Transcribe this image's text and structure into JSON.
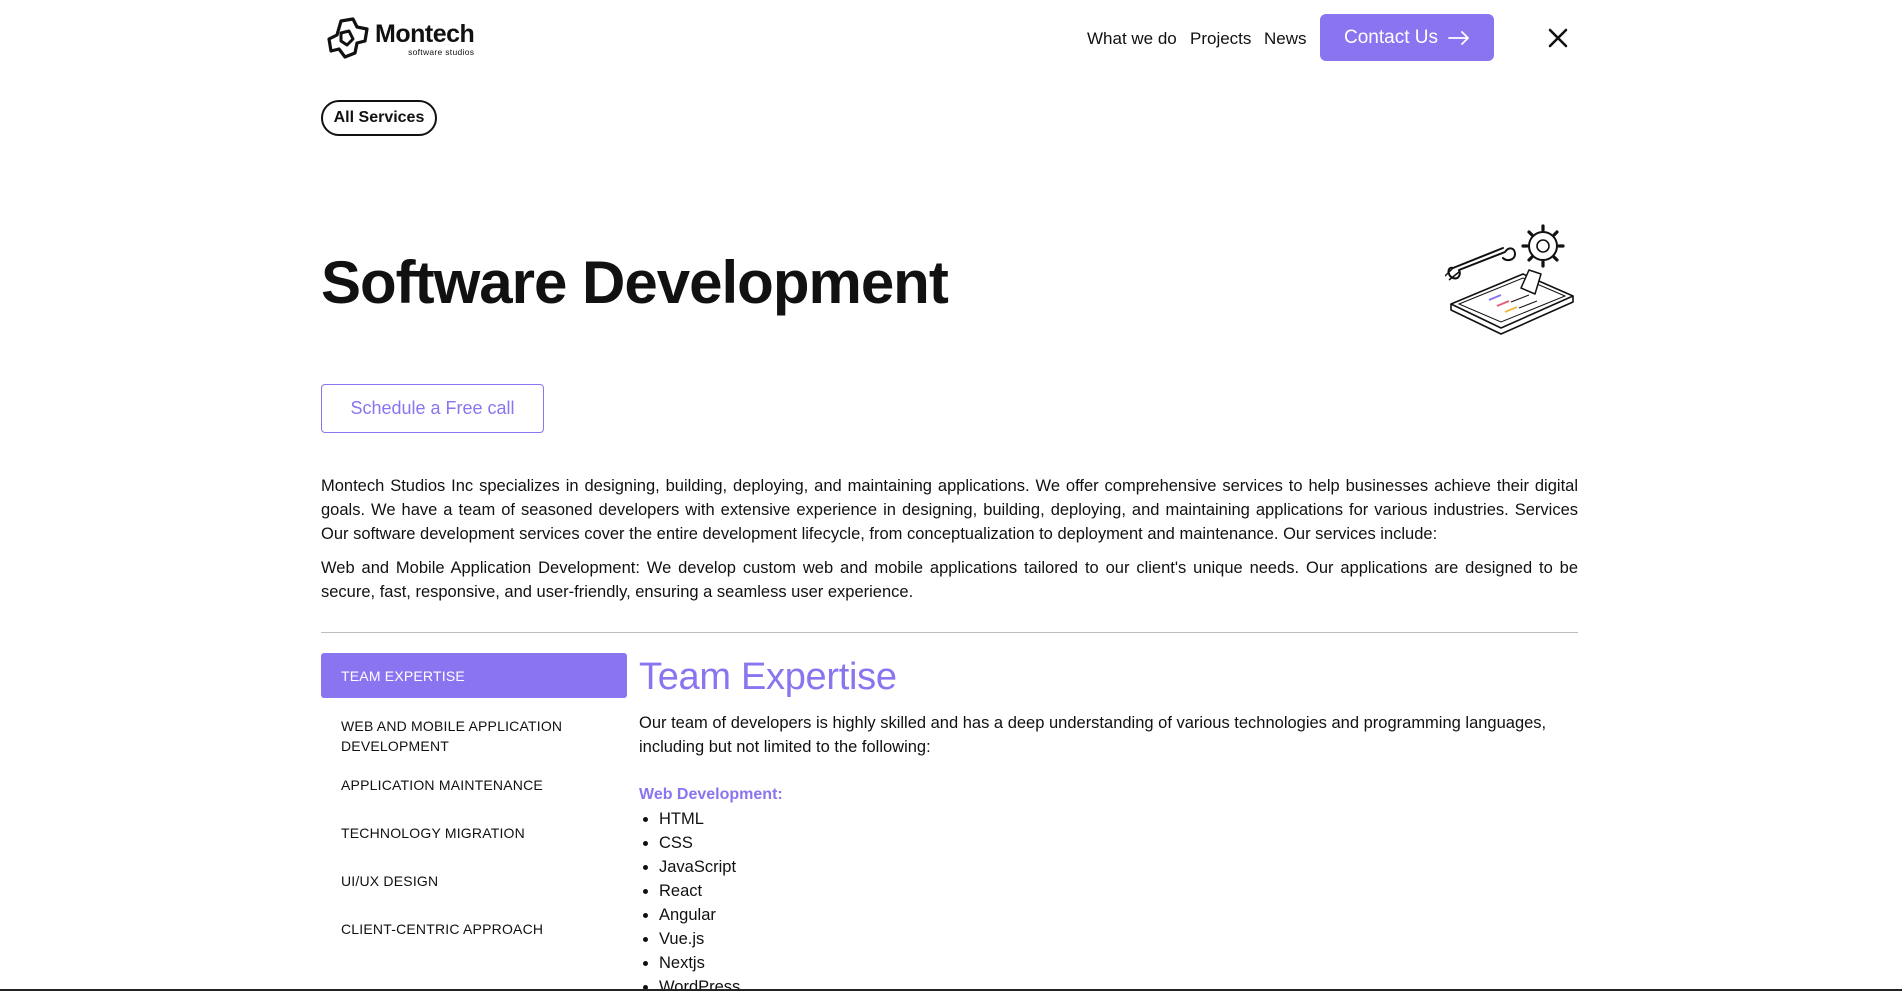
{
  "brand": {
    "name": "Montech",
    "tagline": "software studios"
  },
  "nav": {
    "what_we_do": "What we do",
    "projects": "Projects",
    "news": "News",
    "contact": "Contact Us"
  },
  "pill": {
    "label": "All Services"
  },
  "page_title": "Software Development",
  "schedule_button": "Schedule a Free call",
  "intro": [
    "Montech Studios Inc specializes in designing, building, deploying, and maintaining applications. We offer comprehensive services to help businesses achieve their digital goals. We have a team of seasoned developers with extensive experience in designing, building, deploying, and maintaining applications for various industries. Services Our software development services cover the entire development lifecycle, from conceptualization to deployment and maintenance. Our services include:",
    "Web and Mobile Application Development: We develop custom web and mobile applications tailored to our client's unique needs. Our applications are designed to be secure, fast, responsive, and user-friendly, ensuring a seamless user experience."
  ],
  "tabs": [
    {
      "label": "TEAM EXPERTISE",
      "active": true
    },
    {
      "label": "WEB AND MOBILE APPLICATION DEVELOPMENT",
      "active": false
    },
    {
      "label": "APPLICATION MAINTENANCE",
      "active": false
    },
    {
      "label": "TECHNOLOGY MIGRATION",
      "active": false
    },
    {
      "label": "UI/UX DESIGN",
      "active": false
    },
    {
      "label": "CLIENT-CENTRIC APPROACH",
      "active": false
    }
  ],
  "content": {
    "title": "Team Expertise",
    "description": "Our team of developers is highly skilled and has a deep understanding of various technologies and programming languages, including but not limited to the following:",
    "sub_heading": "Web Development:",
    "items": [
      "HTML",
      "CSS",
      "JavaScript",
      "React",
      "Angular",
      "Vue.js",
      "Nextjs",
      "WordPress"
    ]
  },
  "colors": {
    "accent": "#8b74f0",
    "text": "#111111",
    "background": "#ffffff"
  },
  "icons": {
    "close": "close-icon",
    "arrow": "arrow-right-icon",
    "logo": "logo-icon",
    "illustration": "tools-tablet-illustration"
  }
}
